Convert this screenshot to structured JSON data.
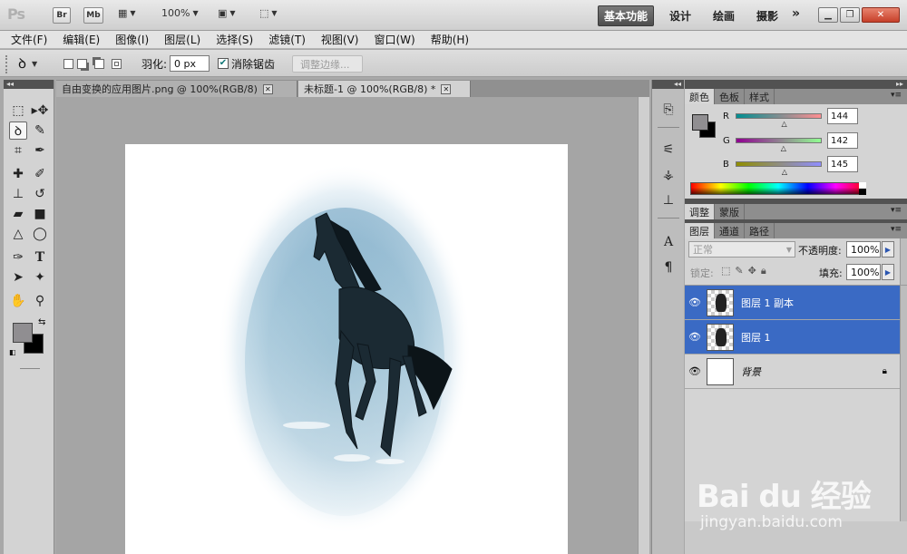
{
  "appbar": {
    "logo": "Ps",
    "bridge": "Br",
    "minibridge": "Mb",
    "zoom": "100%",
    "workspaces": [
      "基本功能",
      "设计",
      "绘画",
      "摄影"
    ],
    "more": "»"
  },
  "menu": [
    "文件(F)",
    "编辑(E)",
    "图像(I)",
    "图层(L)",
    "选择(S)",
    "滤镜(T)",
    "视图(V)",
    "窗口(W)",
    "帮助(H)"
  ],
  "options": {
    "feather_label": "羽化:",
    "feather_value": "0 px",
    "antialias_label": "消除锯齿",
    "antialias_checked": true,
    "refine_edge": "调整边缘..."
  },
  "documents": {
    "tabs": [
      {
        "title": "自由变换的应用图片.png @ 100%(RGB/8)",
        "active": false
      },
      {
        "title": "未标题-1 @ 100%(RGB/8) *",
        "active": true
      }
    ]
  },
  "color_panel": {
    "tabs": [
      "颜色",
      "色板",
      "样式"
    ],
    "foreground": "#908e91",
    "background": "#000000",
    "channels": [
      {
        "label": "R",
        "value": "144",
        "level": 0.565
      },
      {
        "label": "G",
        "value": "142",
        "level": 0.557
      },
      {
        "label": "B",
        "value": "145",
        "level": 0.569
      }
    ]
  },
  "adjust_panel": {
    "tabs": [
      "调整",
      "蒙版"
    ]
  },
  "layers_panel": {
    "tabs": [
      "图层",
      "通道",
      "路径"
    ],
    "blend_mode": "正常",
    "opacity_label": "不透明度:",
    "opacity_value": "100%",
    "lock_label": "锁定:",
    "fill_label": "填充:",
    "fill_value": "100%",
    "layers": [
      {
        "name": "图层 1 副本",
        "selected": true,
        "thumb": "horse"
      },
      {
        "name": "图层 1",
        "selected": true,
        "thumb": "horse"
      },
      {
        "name": "背景",
        "selected": false,
        "thumb": "white",
        "locked": true
      }
    ]
  },
  "watermark": {
    "main": "Bai du 经验",
    "sub": "jingyan.baidu.com"
  },
  "accent_colors": {
    "selection": "#3a6ac4",
    "close": "#c7402a"
  }
}
